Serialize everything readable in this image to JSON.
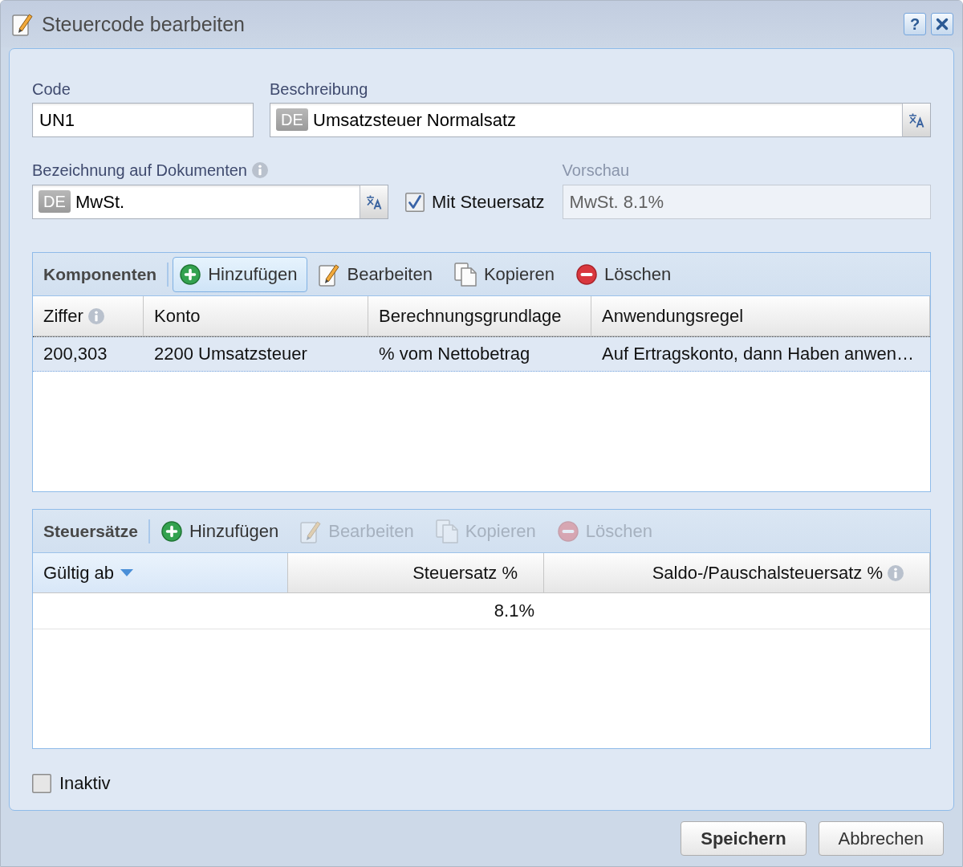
{
  "window": {
    "title": "Steuercode bearbeiten",
    "help_label": "?"
  },
  "code": {
    "label": "Code",
    "value": "UN1"
  },
  "description": {
    "label": "Beschreibung",
    "language": "DE",
    "value": "Umsatzsteuer Normalsatz"
  },
  "document_name": {
    "label": "Bezeichnung auf Dokumenten",
    "language": "DE",
    "value": "MwSt."
  },
  "with_rate": {
    "label": "Mit Steuersatz",
    "checked": true
  },
  "preview": {
    "label": "Vorschau",
    "value": "MwSt. 8.1%",
    "disabled": true
  },
  "components": {
    "title": "Komponenten",
    "toolbar": [
      {
        "kind": "add",
        "label": "Hinzufügen",
        "disabled": false,
        "highlighted": true
      },
      {
        "kind": "edit",
        "label": "Bearbeiten",
        "disabled": false,
        "highlighted": false
      },
      {
        "kind": "copy",
        "label": "Kopieren",
        "disabled": false,
        "highlighted": false
      },
      {
        "kind": "delete",
        "label": "Löschen",
        "disabled": false,
        "highlighted": false
      }
    ],
    "columns": [
      {
        "label": "Ziffer",
        "info": true,
        "sorted": false
      },
      {
        "label": "Konto",
        "info": false,
        "sorted": false
      },
      {
        "label": "Berechnungsgrundlage",
        "info": false,
        "sorted": false
      },
      {
        "label": "Anwendungsregel",
        "info": false,
        "sorted": false
      }
    ],
    "rows": [
      {
        "selected": true,
        "cells": [
          "200,303",
          "2200 Umsatzsteuer",
          "% vom Nettobetrag",
          "Auf Ertragskonto, dann Haben anwen…"
        ]
      }
    ]
  },
  "rates": {
    "title": "Steuersätze",
    "toolbar": [
      {
        "kind": "add",
        "label": "Hinzufügen",
        "disabled": false,
        "highlighted": false
      },
      {
        "kind": "edit",
        "label": "Bearbeiten",
        "disabled": true,
        "highlighted": false
      },
      {
        "kind": "copy",
        "label": "Kopieren",
        "disabled": true,
        "highlighted": false
      },
      {
        "kind": "delete",
        "label": "Löschen",
        "disabled": true,
        "highlighted": false
      }
    ],
    "columns": [
      {
        "label": "Gültig ab",
        "info": false,
        "sorted": true
      },
      {
        "label": "Steuersatz %",
        "info": false,
        "sorted": false
      },
      {
        "label": "Saldo-/Pauschalsteuersatz %",
        "info": true,
        "sorted": false
      }
    ],
    "rows": [
      {
        "selected": false,
        "rate": "8.1%"
      }
    ]
  },
  "inactive": {
    "label": "Inaktiv",
    "checked": false
  },
  "buttons": [
    {
      "kind": "primary",
      "label": "Speichern"
    },
    {
      "kind": "secondary",
      "label": "Abbrechen"
    }
  ]
}
